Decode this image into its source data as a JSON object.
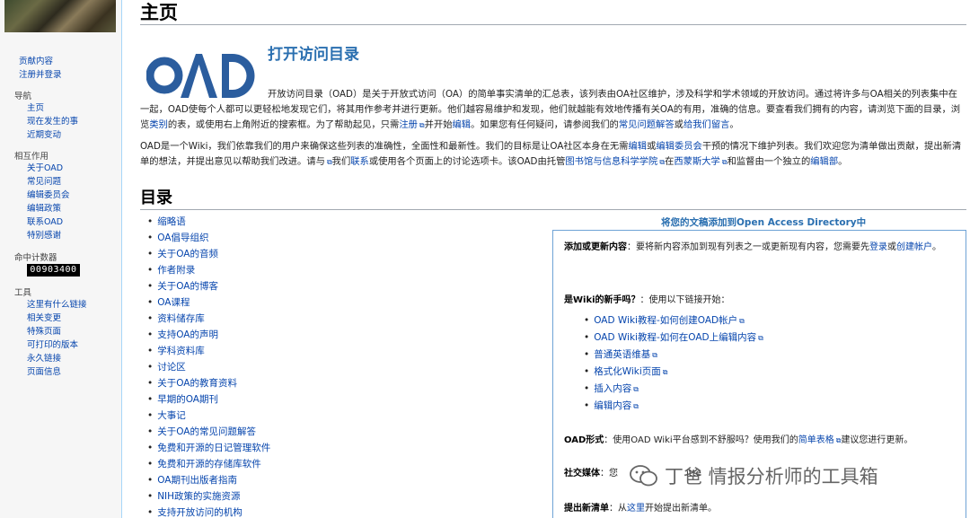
{
  "sidebar": {
    "personal": [
      "贡献内容",
      "注册并登录"
    ],
    "nav_heading": "导航",
    "nav_items": [
      "主页",
      "现在发生的事",
      "近期变动"
    ],
    "interact_heading": "相互作用",
    "interact_items": [
      "关于OAD",
      "常见问题",
      "编辑委员会",
      "编辑政策",
      "联系OAD",
      "特别感谢"
    ],
    "counter_heading": "命中计数器",
    "counter_value": "00903400",
    "tools_heading": "工具",
    "tools_items": [
      "这里有什么链接",
      "相关变更",
      "特殊页面",
      "可打印的版本",
      "永久链接",
      "页面信息"
    ]
  },
  "page": {
    "title": "主页",
    "logo_text": "OAD",
    "intro_heading": "打开访问目录",
    "para1": {
      "t1": "开放访问目录（OAD）是关于开放式访问（OA）的简单事实清单的汇总表，该列表由OA社区维护，涉及科学和学术领域的开放访问。通过将许多与OA相关的列表集中在一起，OAD使每个人都可以更轻松地发现它们，将其用作参考并进行更新。他们越容易维护和发现，他们就越能有效地传播有关OA的有用，准确的信息。要查看我们拥有的内容，请浏览下面的目录，浏览",
      "l1": "类别",
      "t2": "的表，或使用右上角附近的搜索框。为了帮助起见，只需",
      "l2": "注册",
      "t3": "并开始",
      "l3": "编辑",
      "t4": "。如果您有任何疑问，请参阅我们的",
      "l4": "常见问题解答",
      "t5": "或",
      "l5": "给我们留言",
      "t6": "。"
    },
    "para2": {
      "t1": "OAD是一个Wiki，我们依靠我们的用户来确保这些列表的准确性，全面性和最新性。我们的目标是让OA社区本身在无需",
      "l1": "编辑",
      "t2": "或",
      "l2": "编辑委员会",
      "t3": "干预的情况下维护列表。我们欢迎您为清单做出贡献，提出新清单的想法，并提出意见以帮助我们改进。请与",
      "t4": "我们",
      "l3": "联系",
      "t5": "或使用各个页面上的讨论选项卡。该OAD由托管",
      "l4": "图书馆与信息科学学院",
      "t6": "在",
      "l5": "西蒙斯大学",
      "t7": "和监督由一个独立的",
      "l6": "编辑部",
      "t8": "。"
    },
    "toc_title": "目录",
    "toc_items": [
      "缩略语",
      "OA倡导组织",
      "关于OA的音频",
      "作者附录",
      "关于OA的博客",
      "OA课程",
      "资料储存库",
      "支持OA的声明",
      "学科资料库",
      "讨论区",
      "关于OA的教育资料",
      "早期的OA期刊",
      "大事记",
      "关于OA的常见问题解答",
      "免费和开源的日记管理软件",
      "免费和开源的存储库软件",
      "OA期刊出版者指南",
      "NIH政策的实施资源",
      "支持开放访问的机构"
    ]
  },
  "panel": {
    "title": "将您的文稿添加到Open Access Directory中",
    "add_label": "添加或更新内容",
    "add_text": "：要将新内容添加到现有列表之一或更新现有内容，您需要先",
    "add_login": "登录",
    "add_or": "或",
    "add_create": "创建帐户",
    "add_end": "。",
    "newbie_label": "是Wiki的新手吗？",
    "newbie_text": "：使用以下链接开始：",
    "links": [
      "OAD Wiki教程-如何创建OAD帐户",
      "OAD Wiki教程-如何在OAD上编辑内容",
      "普通英语维基",
      "格式化Wiki页面",
      "插入内容",
      "编辑内容"
    ],
    "format_label": "OAD形式",
    "format_text": "：使用OAD Wiki平台感到不舒服吗？使用我们的",
    "format_link": "简单表格",
    "format_end": "建议您进行更新。",
    "social_label": "社交媒体",
    "social_text": "：您",
    "social_tail": "itte",
    "suggest_label": "提出新清单",
    "suggest_text": "：从",
    "suggest_link": "这里",
    "suggest_end": "开始提出新清单。"
  },
  "watermark": {
    "text": "丁爸 情报分析师的工具箱"
  },
  "colors": {
    "link": "#0645ad",
    "heading_blue": "#2a6fb0",
    "logo_blue": "#2b5d9e",
    "panel_border": "#6fa3d6"
  }
}
